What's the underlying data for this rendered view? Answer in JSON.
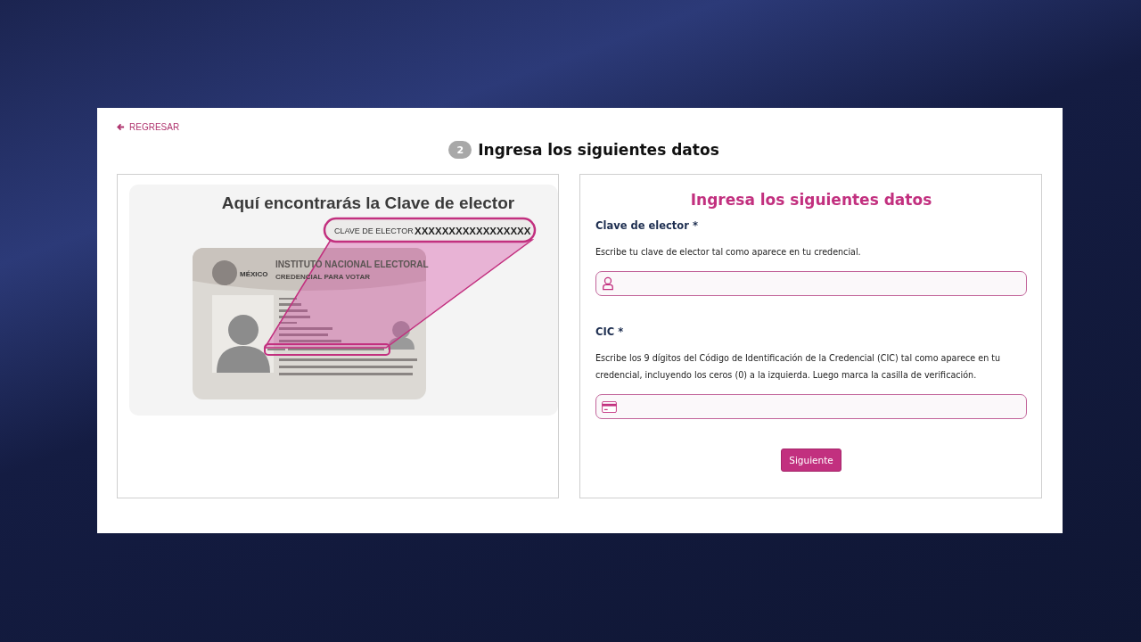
{
  "back_link": "REGRESAR",
  "step": {
    "number": "2",
    "title": "Ingresa los siguientes datos"
  },
  "illustration": {
    "title": "Aquí encontrarás la Clave de elector",
    "callout_label": "CLAVE DE ELECTOR",
    "callout_value": "XXXXXXXXXXXXXXXXX",
    "card_country": "MÉXICO",
    "card_institution": "INSTITUTO NACIONAL ELECTORAL",
    "card_type": "CREDENCIAL PARA VOTAR"
  },
  "form": {
    "title": "Ingresa los siguientes datos",
    "fields": [
      {
        "label": "Clave de elector *",
        "hint": "Escribe tu clave de elector tal como aparece en tu credencial.",
        "kind": "user"
      },
      {
        "label": "CIC *",
        "hint": "Escribe los 9 dígitos del Código de Identificación de la Credencial (CIC) tal como aparece en tu credencial, incluyendo los ceros (0) a la izquierda. Luego marca la casilla de verificación.",
        "kind": "card"
      }
    ],
    "submit": "Siguiente"
  }
}
